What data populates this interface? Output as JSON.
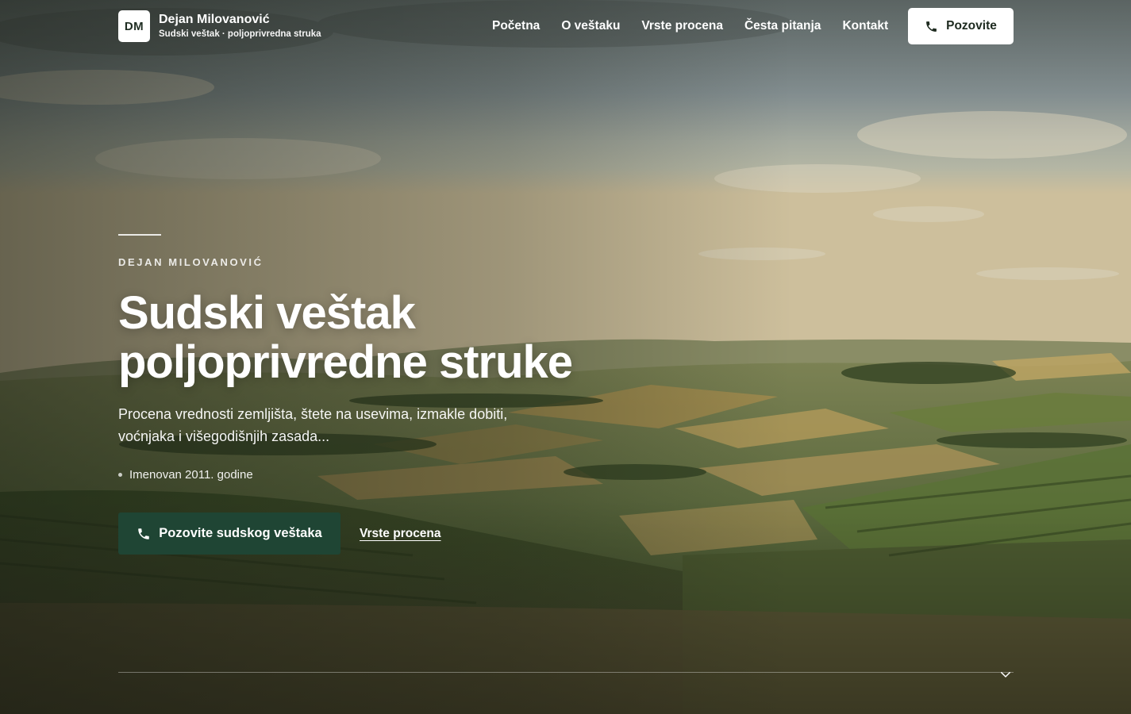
{
  "brand": {
    "logo_text": "DM",
    "name": "Dejan Milovanović",
    "subtitle": "Sudski veštak · poljoprivredna struka"
  },
  "nav": {
    "items": [
      "Početna",
      "O veštaku",
      "Vrste procena",
      "Česta pitanja",
      "Kontakt"
    ]
  },
  "header_cta": {
    "label": "Pozovite",
    "icon": "phone-icon"
  },
  "hero": {
    "eyebrow": "DEJAN MILOVANOVIĆ",
    "headline_line1": "Sudski veštak",
    "headline_line2": "poljoprivredne struke",
    "lede": "Procena vrednosti zemljišta, štete na usevima, izmakle dobiti, voćnjaka i višegodišnjih zasada...",
    "bullet": "Imenovan 2011. godine",
    "primary_cta": "Pozovite sudskog veštaka",
    "secondary_cta": "Vrste procena"
  },
  "colors": {
    "primary_button": "#1f4534",
    "header_button_bg": "#ffffff",
    "text": "#ffffff"
  },
  "scroll_indicator": "chevron-down-icon"
}
